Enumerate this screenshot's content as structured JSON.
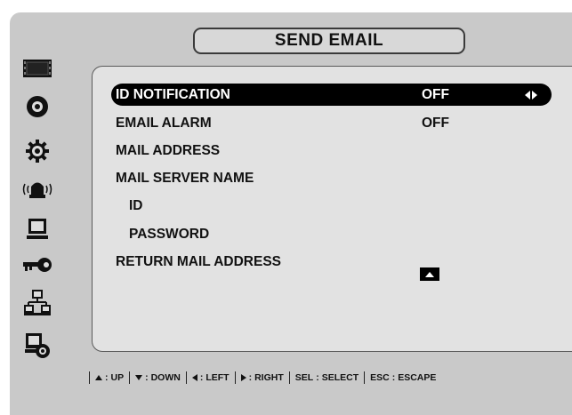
{
  "title": "SEND EMAIL",
  "sidebar": {
    "icons": [
      "monitor-display-icon",
      "record-disc-icon",
      "settings-gear-icon",
      "alarm-siren-icon",
      "computer-terminal-icon",
      "key-icon",
      "network-icon",
      "backup-device-icon"
    ]
  },
  "menu": {
    "items": [
      {
        "label": "ID NOTIFICATION",
        "value": "OFF",
        "selected": true
      },
      {
        "label": "EMAIL ALARM",
        "value": "OFF"
      },
      {
        "label": "MAIL ADDRESS"
      },
      {
        "label": "MAIL SERVER NAME"
      },
      {
        "label": "ID"
      },
      {
        "label": "PASSWORD"
      },
      {
        "label": "RETURN MAIL ADDRESS"
      }
    ]
  },
  "footer": {
    "up": "UP",
    "down": "DOWN",
    "left": "LEFT",
    "right": "RIGHT",
    "sel_key": "SEL",
    "sel": "SELECT",
    "esc_key": "ESC",
    "esc": "ESCAPE"
  },
  "colors": {
    "background": "#c9c9c9",
    "panel": "#e2e2e2",
    "selected": "#000000"
  }
}
